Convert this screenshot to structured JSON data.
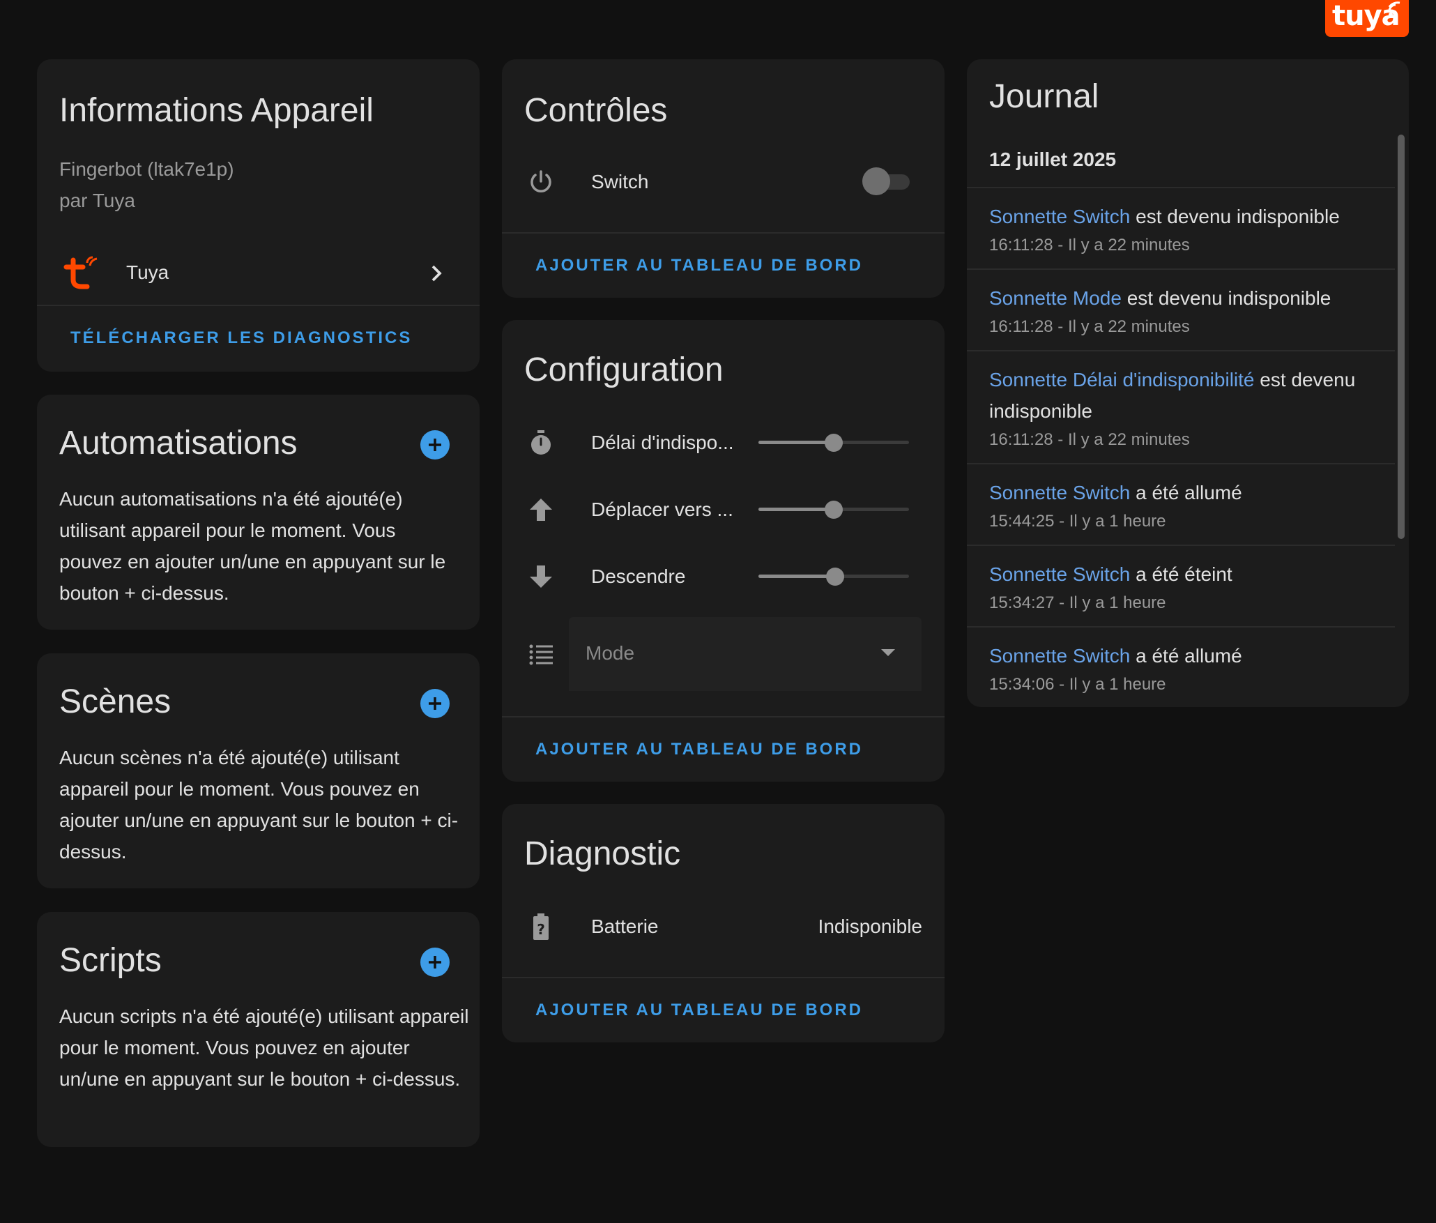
{
  "brand": {
    "badge_text": "tuya",
    "color": "#ff4800"
  },
  "device_info": {
    "title": "Informations Appareil",
    "model": "Fingerbot (ltak7e1p)",
    "manufacturer": "par Tuya",
    "integration_name": "Tuya",
    "download_diagnostics": "TÉLÉCHARGER LES DIAGNOSTICS"
  },
  "automations": {
    "title": "Automatisations",
    "empty_text": "Aucun automatisations n'a été ajouté(e) utilisant appareil pour le moment. Vous pouvez en ajouter un/une en appuyant sur le bouton + ci-dessus."
  },
  "scenes": {
    "title": "Scènes",
    "empty_text": "Aucun scènes n'a été ajouté(e) utilisant appareil pour le moment. Vous pouvez en ajouter un/une en appuyant sur le bouton + ci-dessus."
  },
  "scripts": {
    "title": "Scripts",
    "empty_text": "Aucun scripts n'a été ajouté(e) utilisant appareil pour le moment. Vous pouvez en ajouter un/une en appuyant sur le bouton + ci-dessus."
  },
  "controls": {
    "title": "Contrôles",
    "switch_label": "Switch",
    "switch_on": false,
    "add_to_dashboard": "AJOUTER AU TABLEAU DE BORD"
  },
  "configuration": {
    "title": "Configuration",
    "rows": [
      {
        "label": "Délai d'indispo...",
        "icon": "timer-icon",
        "value_fraction": 0.5
      },
      {
        "label": "Déplacer vers ...",
        "icon": "arrow-up-icon",
        "value_fraction": 0.5
      },
      {
        "label": "Descendre",
        "icon": "arrow-down-icon",
        "value_fraction": 0.51
      }
    ],
    "select_placeholder": "Mode",
    "add_to_dashboard": "AJOUTER AU TABLEAU DE BORD"
  },
  "diagnostic": {
    "title": "Diagnostic",
    "battery_label": "Batterie",
    "battery_value": "Indisponible",
    "add_to_dashboard": "AJOUTER AU TABLEAU DE BORD"
  },
  "journal": {
    "title": "Journal",
    "date": "12 juillet 2025",
    "entries": [
      {
        "entity": "Sonnette Switch",
        "message": " est devenu indisponible",
        "time": "16:11:28 - Il y a 22 minutes"
      },
      {
        "entity": "Sonnette Mode",
        "message": " est devenu indisponible",
        "time": "16:11:28 - Il y a 22 minutes"
      },
      {
        "entity": "Sonnette Délai d'indisponibilité",
        "message": " est devenu indisponible",
        "time": "16:11:28 - Il y a 22 minutes"
      },
      {
        "entity": "Sonnette Switch",
        "message": " a été allumé",
        "time": "15:44:25 - Il y a 1 heure"
      },
      {
        "entity": "Sonnette Switch",
        "message": " a été éteint",
        "time": "15:34:27 - Il y a 1 heure"
      },
      {
        "entity": "Sonnette Switch",
        "message": " a été allumé",
        "time": "15:34:06 - Il y a 1 heure"
      }
    ]
  },
  "colors": {
    "accent": "#3e9de8",
    "entity_link": "#6aa3e8",
    "card_bg": "#1c1c1c",
    "page_bg": "#111111"
  }
}
